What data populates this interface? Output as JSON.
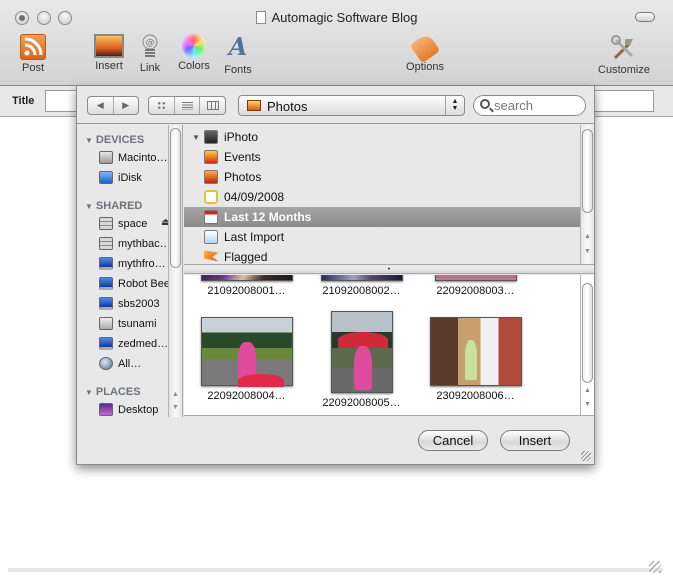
{
  "window": {
    "title": "Automagic Software Blog"
  },
  "toolbar": {
    "items": [
      {
        "label": "Post",
        "icon": "rss-icon"
      },
      {
        "label": "Insert",
        "icon": "picture-icon"
      },
      {
        "label": "Link",
        "icon": "link-spring-icon"
      },
      {
        "label": "Colors",
        "icon": "color-wheel-icon"
      },
      {
        "label": "Fonts",
        "icon": "font-icon"
      },
      {
        "label": "Options",
        "icon": "tag-icon"
      },
      {
        "label": "Customize",
        "icon": "tools-icon"
      }
    ]
  },
  "post": {
    "title_label": "Title",
    "title_value": ""
  },
  "media_browser": {
    "nav": {
      "back": "◀",
      "forward": "▶"
    },
    "view_modes": [
      "icon",
      "list",
      "column"
    ],
    "source_popup": {
      "selected": "Photos"
    },
    "search": {
      "placeholder": "search",
      "value": ""
    },
    "sidebar": {
      "sections": [
        {
          "title": "DEVICES",
          "items": [
            {
              "label": "Macinto…",
              "icon": "hard-disk-icon"
            },
            {
              "label": "iDisk",
              "icon": "idisk-icon"
            }
          ]
        },
        {
          "title": "SHARED",
          "items": [
            {
              "label": "space",
              "icon": "server-icon",
              "eject": true
            },
            {
              "label": "mythbac…",
              "icon": "server-icon"
            },
            {
              "label": "mythfro…",
              "icon": "monitor-icon"
            },
            {
              "label": "Robot Bee",
              "icon": "monitor-icon"
            },
            {
              "label": "sbs2003",
              "icon": "monitor-icon"
            },
            {
              "label": "tsunami",
              "icon": "tower-icon"
            },
            {
              "label": "zedmed…",
              "icon": "monitor-icon"
            },
            {
              "label": "All…",
              "icon": "network-globe-icon"
            }
          ]
        },
        {
          "title": "PLACES",
          "items": [
            {
              "label": "Desktop",
              "icon": "desktop-icon"
            }
          ]
        }
      ]
    },
    "sources": [
      {
        "label": "iPhoto",
        "icon": "iphoto-icon",
        "expanded": true
      },
      {
        "label": "Events",
        "icon": "events-icon"
      },
      {
        "label": "Photos",
        "icon": "photos-icon"
      },
      {
        "label": "04/09/2008",
        "icon": "album-icon"
      },
      {
        "label": "Last 12 Months",
        "icon": "calendar-icon",
        "selected": true
      },
      {
        "label": "Last Import",
        "icon": "import-icon"
      },
      {
        "label": "Flagged",
        "icon": "flag-icon"
      }
    ],
    "photos": [
      {
        "caption": "21092008001…"
      },
      {
        "caption": "21092008002…"
      },
      {
        "caption": "22092008003…"
      },
      {
        "caption": "22092008004…"
      },
      {
        "caption": "22092008005…"
      },
      {
        "caption": "23092008006…"
      }
    ],
    "buttons": {
      "cancel": "Cancel",
      "insert": "Insert"
    }
  }
}
